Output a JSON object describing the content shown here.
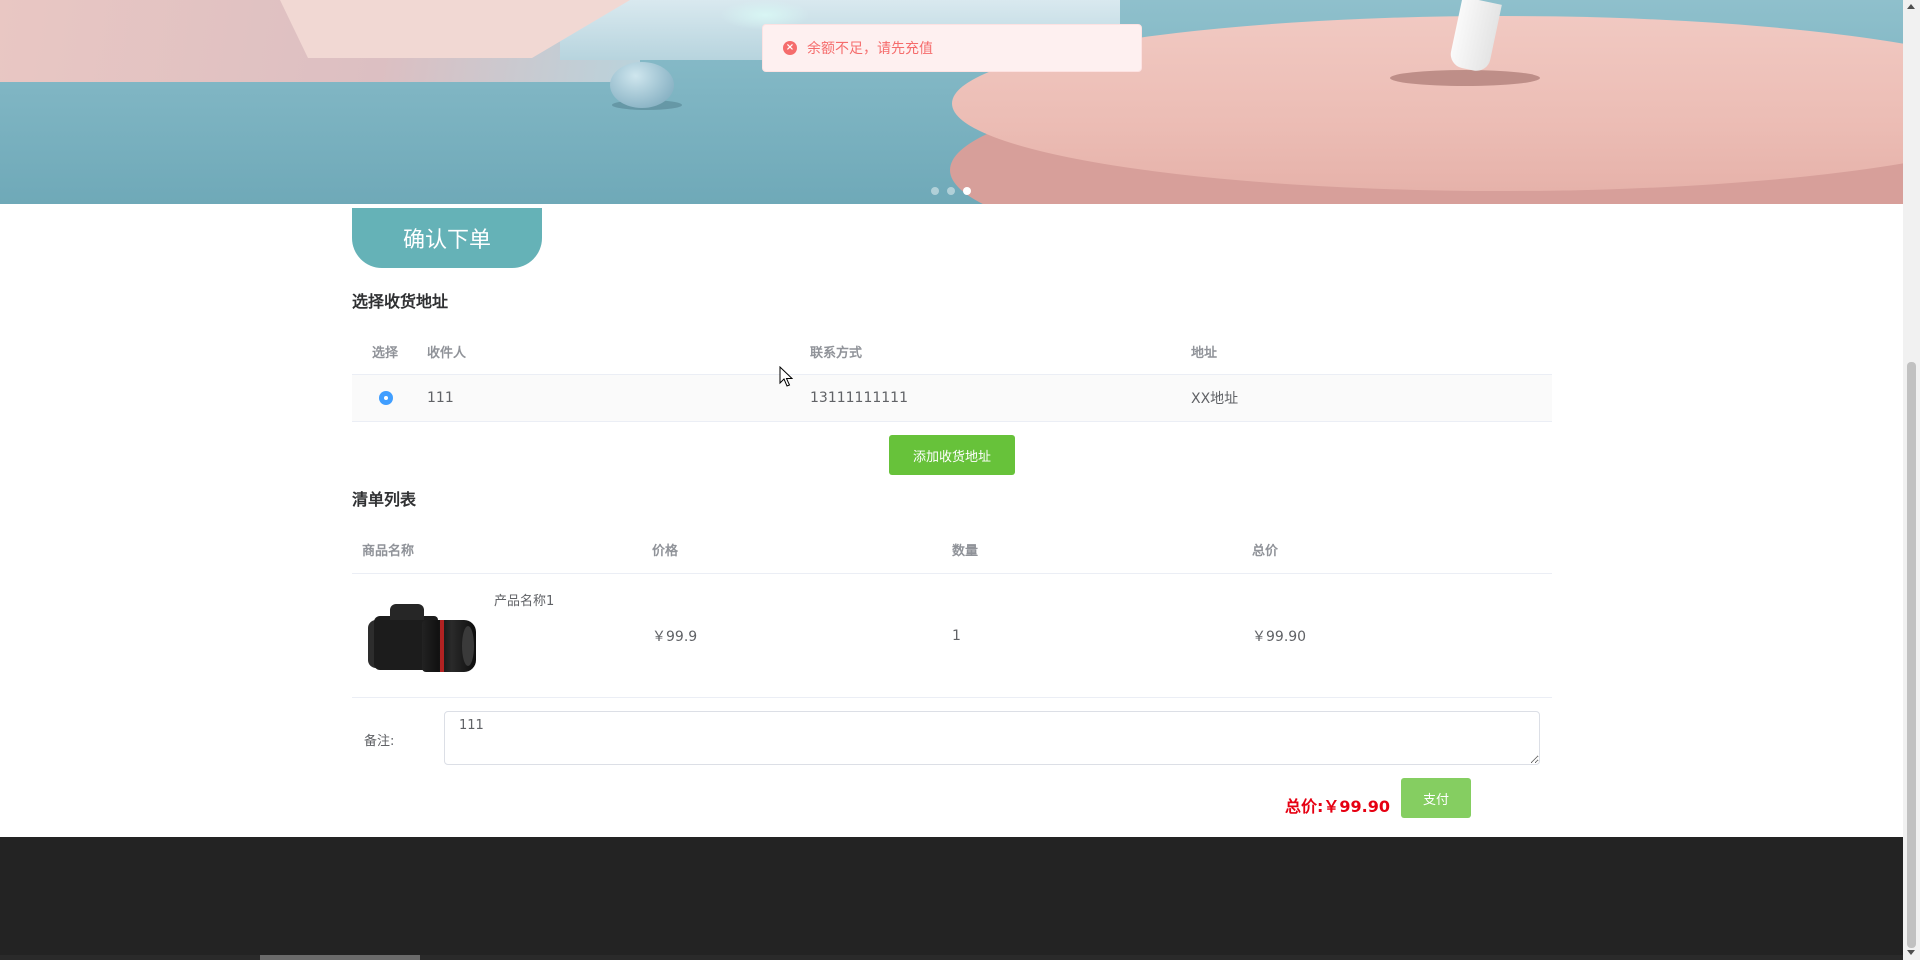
{
  "toast": {
    "message": "余额不足，请先充值",
    "icon": "error-circle-icon",
    "color": "#f56c6c"
  },
  "banner": {
    "dots_count": 3,
    "active_dot_index": 2
  },
  "confirm_tab": {
    "label": "确认下单",
    "color": "#65b2b7"
  },
  "address_section": {
    "title": "选择收货地址",
    "columns": [
      "选择",
      "收件人",
      "联系方式",
      "地址"
    ],
    "rows": [
      {
        "selected": true,
        "recipient": "111",
        "phone": "13111111111",
        "address": "XX地址"
      }
    ],
    "add_button_label": "添加收货地址"
  },
  "cart_section": {
    "title": "清单列表",
    "columns": [
      "商品名称",
      "价格",
      "数量",
      "总价"
    ],
    "items": [
      {
        "name": "产品名称1",
        "image": "camera-product-image",
        "price": "￥99.9",
        "quantity": "1",
        "total": "￥99.90"
      }
    ]
  },
  "note": {
    "label": "备注:",
    "value": "111"
  },
  "summary": {
    "total_label": "总价:",
    "total_value": "￥99.90",
    "pay_button_label": "支付",
    "accent_color": "#e60012"
  },
  "colors": {
    "primary_green": "#67c23a",
    "pay_green": "#85ce61",
    "footer": "#232323"
  }
}
